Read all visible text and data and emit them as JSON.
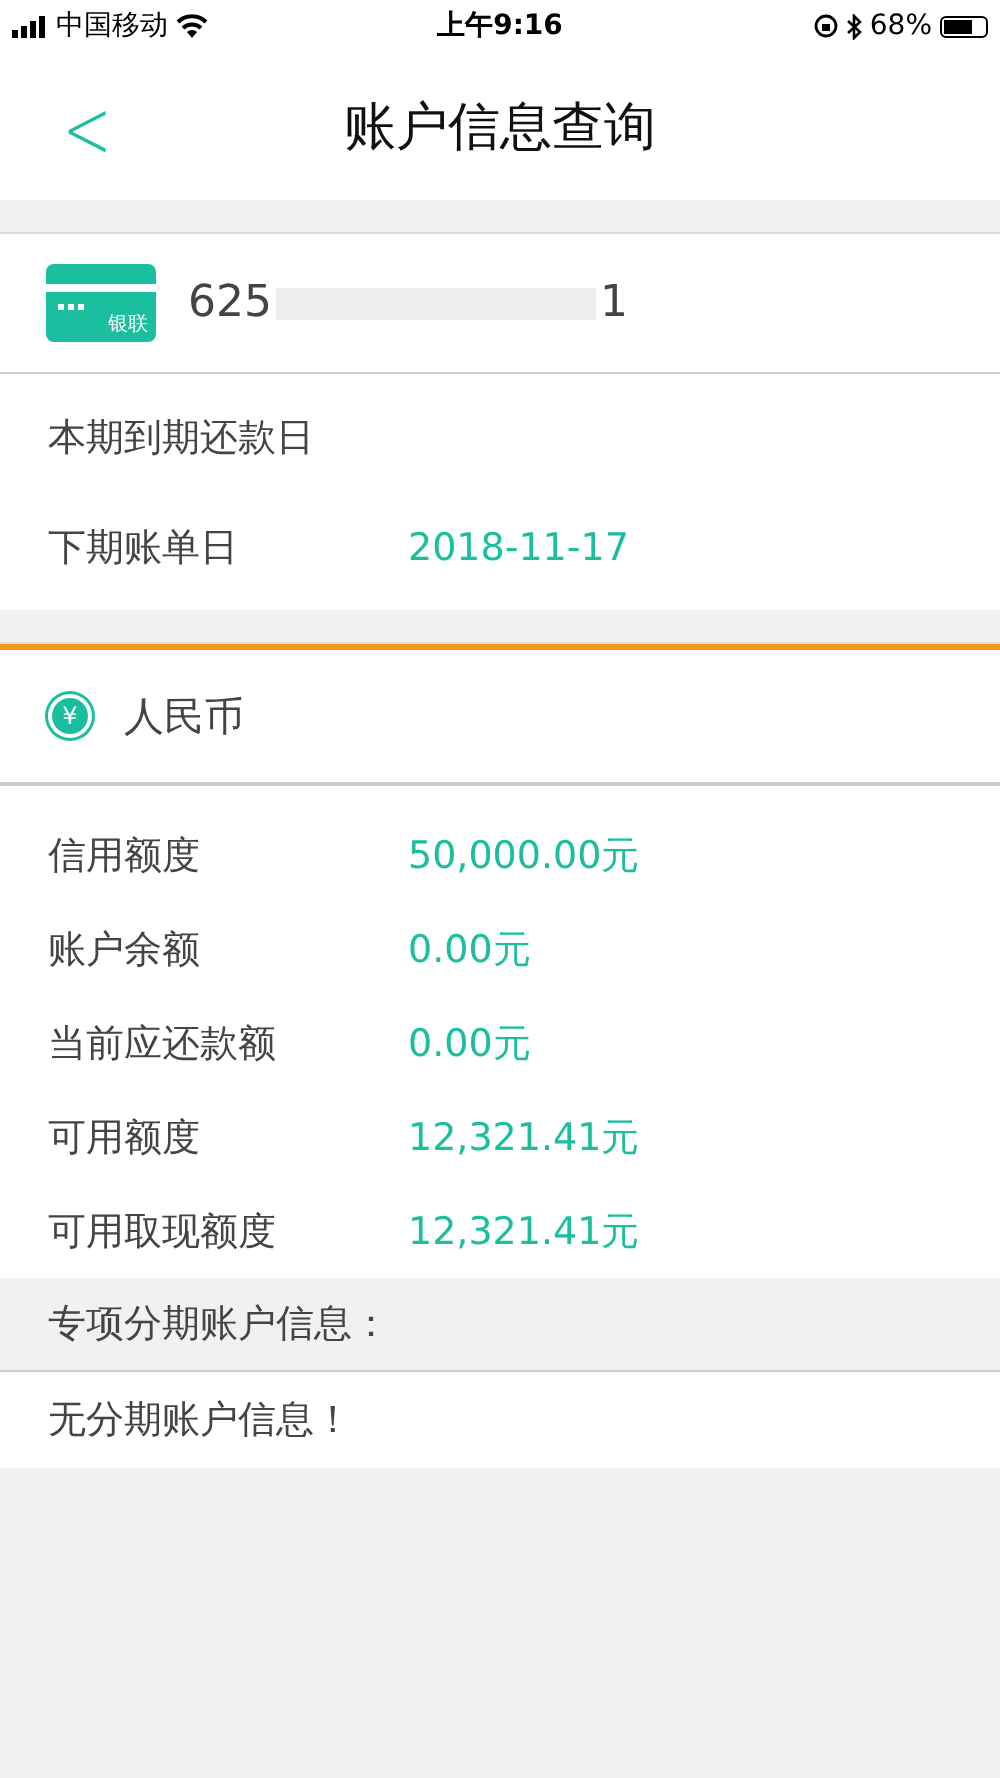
{
  "status_bar": {
    "carrier": "中国移动",
    "time": "上午9:16",
    "battery": "68%"
  },
  "nav": {
    "back": "<",
    "title": "账户信息查询"
  },
  "card": {
    "icon_label": "银联",
    "number_start": "625",
    "number_end": "1"
  },
  "dates": [
    {
      "label": "本期到期还款日"
    },
    {
      "label": "下期账单日",
      "value": "2018-11-17"
    }
  ],
  "currency": {
    "icon": "¥",
    "name": "人民币"
  },
  "amounts": [
    {
      "label": "信用额度",
      "value": "50,000.00元"
    },
    {
      "label": "账户余额",
      "value": "0.00元"
    },
    {
      "label": "当前应还款额",
      "value": "0.00元"
    },
    {
      "label": "可用额度",
      "value": "12,321.41元"
    },
    {
      "label": "可用取现额度",
      "value": "12,321.41元"
    }
  ],
  "installment": {
    "header": "专项分期账户信息：",
    "message": "无分期账户信息！"
  }
}
